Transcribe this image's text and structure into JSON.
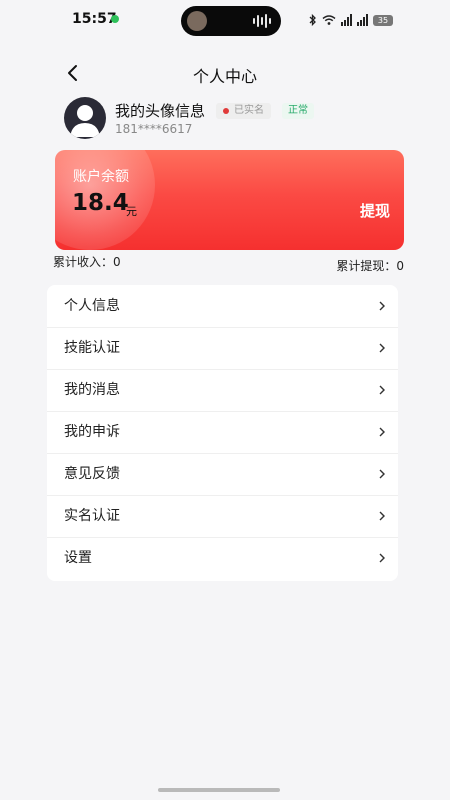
{
  "status_bar": {
    "time": "15:57",
    "battery": "35"
  },
  "nav": {
    "title": "个人中心"
  },
  "profile": {
    "name": "我的头像信息",
    "verified_badge": "已实名",
    "status": "正常",
    "phone": "181****6617"
  },
  "balance": {
    "label": "账户余额",
    "amount": "18.4",
    "unit": "元",
    "withdraw_label": "提现"
  },
  "stats": {
    "income": "累计收入：0",
    "withdrawn": "累计提现：0"
  },
  "menu": {
    "items": [
      {
        "label": "个人信息"
      },
      {
        "label": "技能认证"
      },
      {
        "label": "我的消息"
      },
      {
        "label": "我的申诉"
      },
      {
        "label": "意见反馈"
      },
      {
        "label": "实名认证"
      },
      {
        "label": "设置"
      }
    ]
  },
  "colors": {
    "card_start": "#fe6e5c",
    "card_end": "#f5302f",
    "status_green": "#27a96a",
    "verified_dot": "#e03a3a"
  },
  "icons": {
    "back": "chevron-left-icon",
    "menu_arrow": "chevron-right-icon",
    "avatar": "user-avatar-icon"
  }
}
